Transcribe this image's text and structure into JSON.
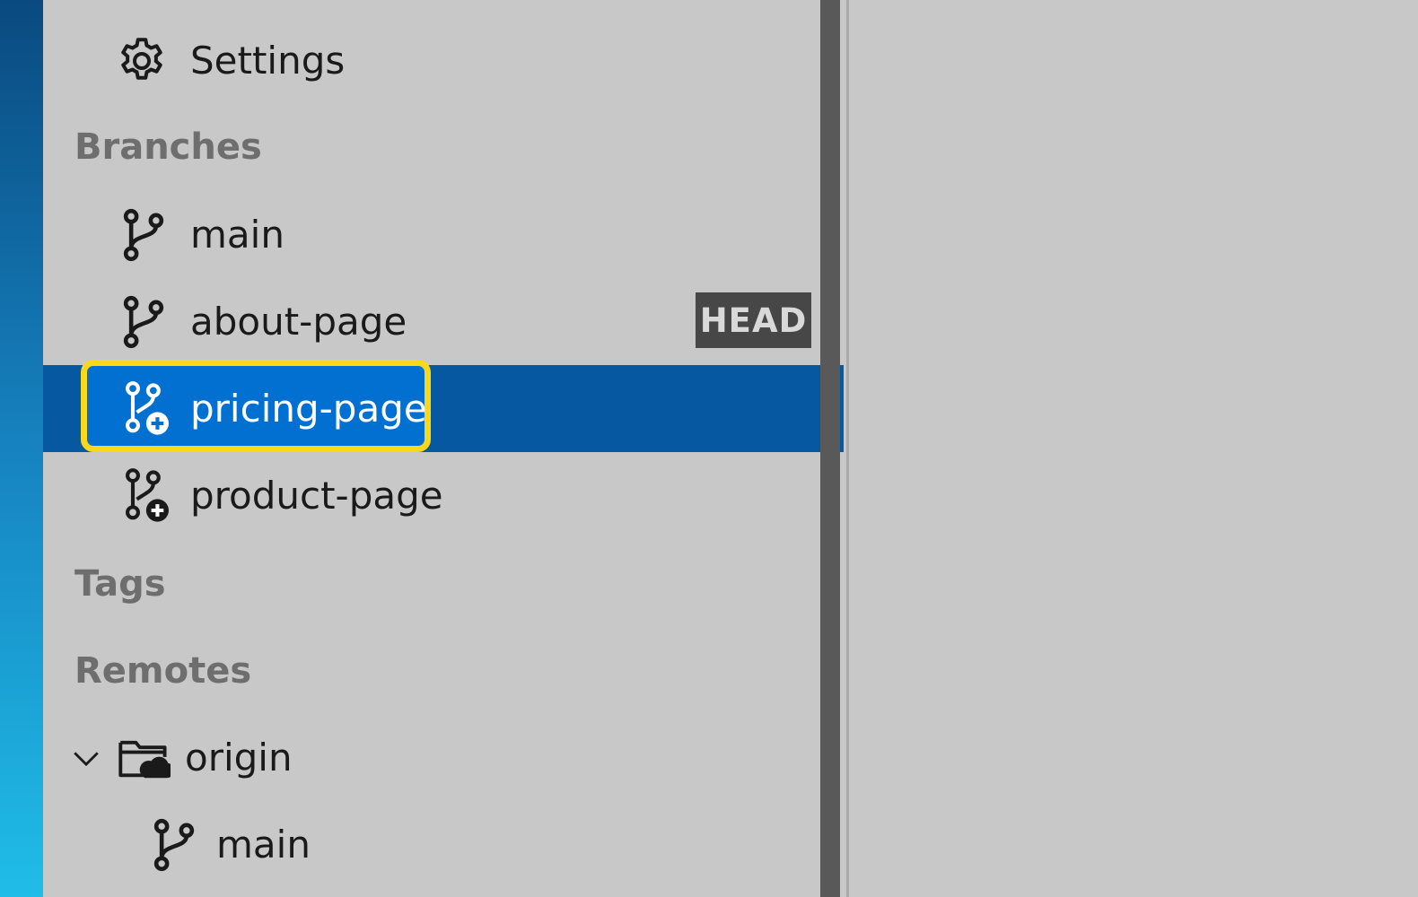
{
  "sidebar": {
    "settings_label": "Settings",
    "sections": {
      "branches": "Branches",
      "tags": "Tags",
      "remotes": "Remotes"
    },
    "branches": [
      {
        "label": "main",
        "icon": "git-branch-icon"
      },
      {
        "label": "about-page",
        "icon": "git-branch-icon",
        "badge": "HEAD"
      },
      {
        "label": "pricing-page",
        "icon": "git-branch-add-icon",
        "selected": true
      },
      {
        "label": "product-page",
        "icon": "git-branch-add-icon"
      }
    ],
    "remotes": {
      "origin_label": "origin",
      "origin_branches": [
        {
          "label": "main",
          "icon": "git-branch-icon"
        }
      ]
    }
  },
  "colors": {
    "selection": "#0659a0",
    "focus_highlight": "#f9d71c",
    "badge_bg": "#474747"
  }
}
